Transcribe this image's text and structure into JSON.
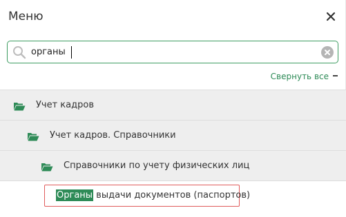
{
  "header": {
    "title": "Меню"
  },
  "search": {
    "value": "органы"
  },
  "collapse": {
    "label": "Свернуть все"
  },
  "tree": {
    "items": [
      {
        "label": "Учет кадров",
        "level": 1
      },
      {
        "label": "Учет кадров. Справочники",
        "level": 2
      },
      {
        "label": "Справочники по учету физических лиц",
        "level": 3
      }
    ]
  },
  "result": {
    "match": "Органы",
    "rest": " выдачи документов (паспортов)"
  },
  "colors": {
    "accent": "#2e8b57",
    "highlight_border": "#e05a5a",
    "row_bg": "#eeeeee"
  }
}
